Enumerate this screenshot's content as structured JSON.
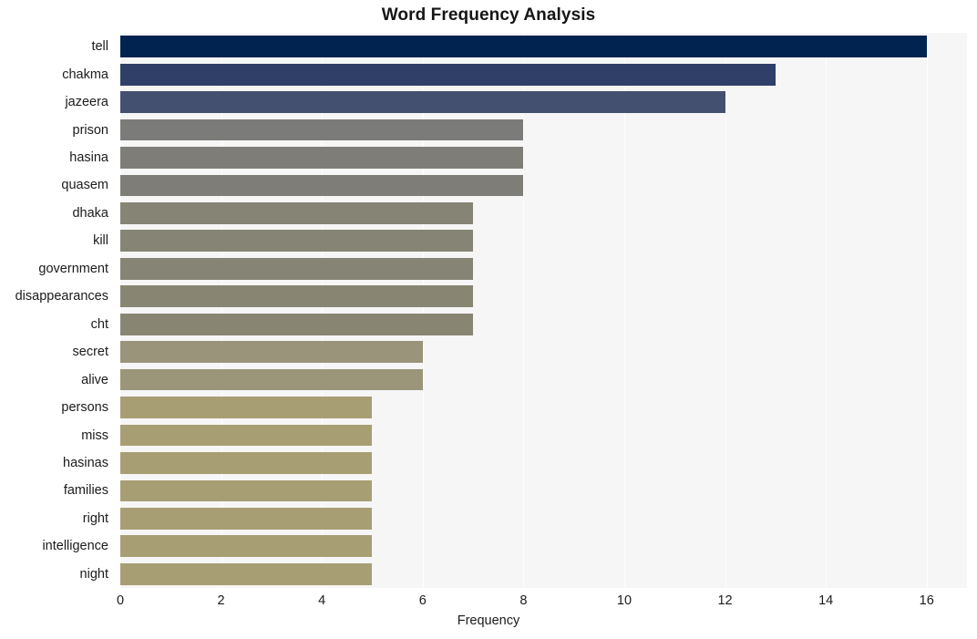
{
  "chart_data": {
    "type": "bar",
    "orientation": "horizontal",
    "title": "Word Frequency Analysis",
    "xlabel": "Frequency",
    "ylabel": "",
    "xlim": [
      0,
      16.8
    ],
    "ylim": [
      0,
      20
    ],
    "grid": true,
    "legend": null,
    "x_ticks": [
      0,
      2,
      4,
      6,
      8,
      10,
      12,
      14,
      16
    ],
    "x_tick_labels": [
      "0",
      "2",
      "4",
      "6",
      "8",
      "10",
      "12",
      "14",
      "16"
    ],
    "categories": [
      "tell",
      "chakma",
      "jazeera",
      "prison",
      "hasina",
      "quasem",
      "dhaka",
      "kill",
      "government",
      "disappearances",
      "cht",
      "secret",
      "alive",
      "persons",
      "miss",
      "hasinas",
      "families",
      "right",
      "intelligence",
      "night"
    ],
    "values": [
      16,
      13,
      12,
      8,
      8,
      8,
      7,
      7,
      7,
      7,
      7,
      6,
      6,
      5,
      5,
      5,
      5,
      5,
      5,
      5
    ],
    "bar_colors": [
      "#00234f",
      "#2f3f68",
      "#44506f",
      "#7b7b79",
      "#7e7d78",
      "#7e7d78",
      "#868475",
      "#868475",
      "#868475",
      "#888673",
      "#888673",
      "#99947a",
      "#9b9679",
      "#a89e74",
      "#a89e74",
      "#a89e74",
      "#a89e74",
      "#a89e74",
      "#a89e74",
      "#a89e74"
    ],
    "plot_background": "#f6f6f7",
    "figure_background": "#ffffff",
    "gridline_color": "#ffffff"
  }
}
